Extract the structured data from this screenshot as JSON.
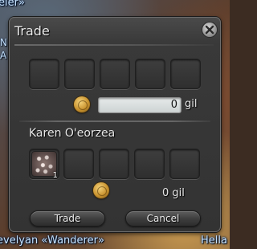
{
  "background": {
    "nameplate_top": "eler»",
    "nameplate_bottom": "evelyan «Wanderer»",
    "nameplate_right": "Hella",
    "edge_glyph_1": "N",
    "edge_glyph_2": "A"
  },
  "window": {
    "title": "Trade",
    "close_icon": "close-x-icon"
  },
  "own_offer": {
    "slot_count": 5,
    "gil_value": "0",
    "gil_unit": "gil",
    "coin_icon": "gil-coin-icon"
  },
  "partner_offer": {
    "name": "Karen O'eorzea",
    "slot_count": 5,
    "items": [
      {
        "slot": 1,
        "icon": "item-icon",
        "quantity": "1"
      }
    ],
    "gil_text": "0 gil",
    "coin_icon": "gil-coin-icon"
  },
  "buttons": {
    "trade_label": "Trade",
    "cancel_label": "Cancel"
  },
  "colors": {
    "nameplate": "#c8e4ff",
    "window_bg": "#333333",
    "coin_gold": "#c8922e",
    "input_bg": "#e6eaea"
  }
}
